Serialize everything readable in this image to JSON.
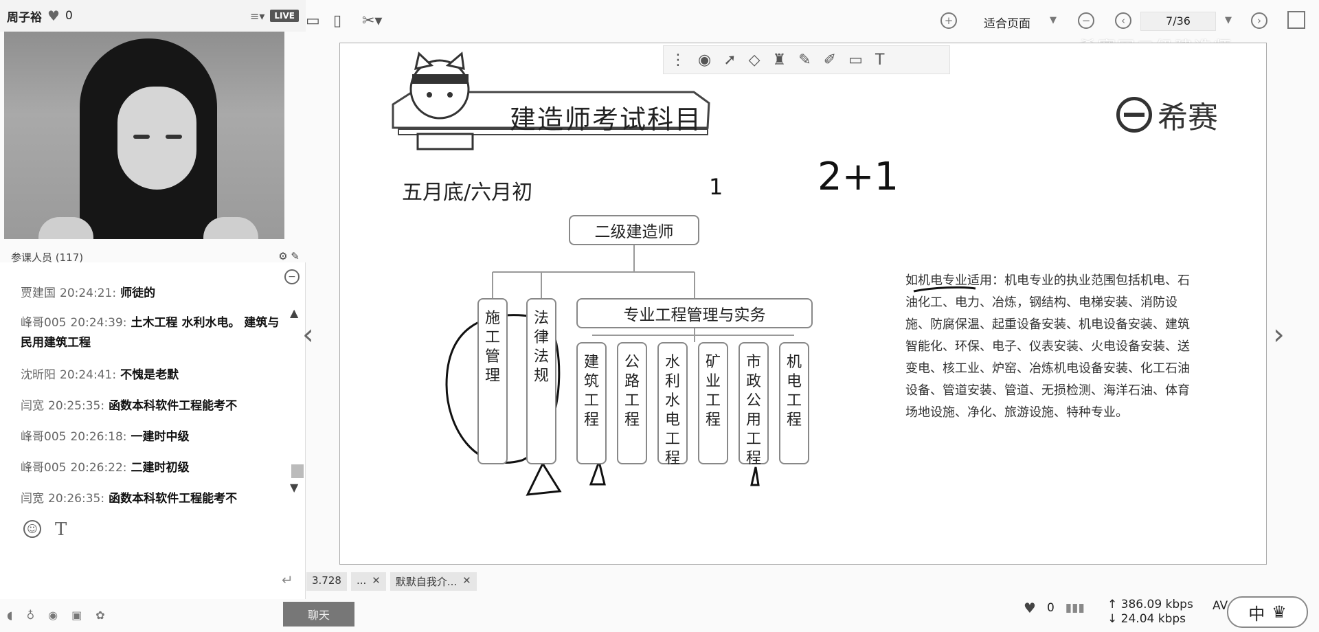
{
  "host": {
    "name": "周子裕",
    "likes": "0",
    "live_badge": "LIVE"
  },
  "audience": {
    "label": "参课人员 (117)"
  },
  "chat": {
    "messages": [
      {
        "who": "贾建国",
        "time": "20:24:21:",
        "msg": "师徒的"
      },
      {
        "who": "峰哥005",
        "time": "20:24:39:",
        "msg": "土木工程  水利水电。 建筑与民用建筑工程"
      },
      {
        "who": "沈昕阳",
        "time": "20:24:41:",
        "msg": "不愧是老默"
      },
      {
        "who": "闫宽",
        "time": "20:25:35:",
        "msg": "函数本科软件工程能考不"
      },
      {
        "who": "峰哥005",
        "time": "20:26:18:",
        "msg": "一建时中级"
      },
      {
        "who": "峰哥005",
        "time": "20:26:22:",
        "msg": "二建时初级"
      },
      {
        "who": "闫宽",
        "time": "20:26:35:",
        "msg": "函数本科软件工程能考不"
      }
    ],
    "tab_label": "聊天"
  },
  "toolbar": {
    "fit_page": "适合页面",
    "page_indicator": "7/36",
    "watermark": "希赛网二级建造师"
  },
  "slide": {
    "title": "建造师考试科目",
    "brand": "希赛",
    "subtitle": "五月底/六月初",
    "handwriting_main": "2+1",
    "handwriting_side": "1",
    "root": "二级建造师",
    "middle": "专业工程管理与实务",
    "left_items": [
      "施工管理",
      "法律法规"
    ],
    "right_items": [
      "建筑工程",
      "公路工程",
      "水利水电工程",
      "矿业工程",
      "市政公用工程",
      "机电工程"
    ],
    "description": "如机电专业适用：机电专业的执业范围包括机电、石油化工、电力、冶炼，钢结构、电梯安装、消防设施、防腐保温、起重设备安装、机电设备安装、建筑智能化、环保、电子、仪表安装、火电设备安装、送变电、核工业、炉窑、冶炼机电设备安装、化工石油设备、管道安装、管道、无损检测、海洋石油、体育场地设施、净化、旅游设施、特种专业。"
  },
  "tabs": [
    {
      "label": "3.728"
    },
    {
      "label": "..."
    },
    {
      "label": "默默自我介..."
    }
  ],
  "status": {
    "likes": "0",
    "up_rate": "386.09 kbps",
    "down_rate": "24.04 kbps",
    "av": "AV",
    "ime": "中"
  }
}
